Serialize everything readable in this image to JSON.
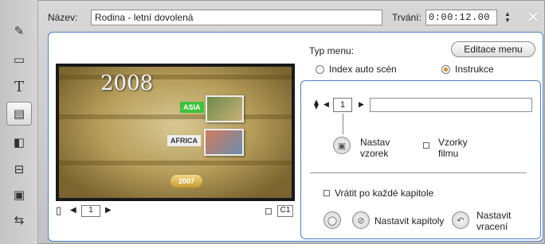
{
  "header": {
    "name_label": "Název:",
    "name_value": "Rodina - letní dovolená",
    "duration_label": "Trvání:",
    "duration_value": "0:00:12.00"
  },
  "leftbar": {
    "tools": [
      "scene-tool",
      "video-tool",
      "title-tool",
      "menu-tool",
      "audio-tool",
      "clapper-tool",
      "frame-tool",
      "transfer-tool"
    ],
    "glyphs": [
      "✎",
      "▭",
      "T",
      "▤",
      "◧",
      "🎬",
      "▣",
      "⇆"
    ]
  },
  "preview": {
    "year_large": "2008",
    "tag_asia": "ASIA",
    "tag_africa": "AFRICA",
    "year_small": "2007",
    "page_number": "1",
    "chapter_code": "C1"
  },
  "menu": {
    "type_label": "Typ menu:",
    "edit_button": "Editace menu",
    "option_auto": "Index auto scén",
    "option_instructions": "Instrukce",
    "selected": "Instrukce"
  },
  "chapter": {
    "number": "1",
    "text_value": "",
    "set_sample_line1": "Nastav",
    "set_sample_line2": "vzorek",
    "film_samples_line1": "Vzorky",
    "film_samples_line2": "filmu",
    "return_after_each": "Vrátit po každé kapitole",
    "set_chapters": "Nastavit kapitoly",
    "set_return_line1": "Nastavit",
    "set_return_line2": "vracení"
  },
  "colors": {
    "accent_blue": "#4f7fc9",
    "radio_on": "#e08a1a",
    "tag_green": "#3ec23a"
  }
}
